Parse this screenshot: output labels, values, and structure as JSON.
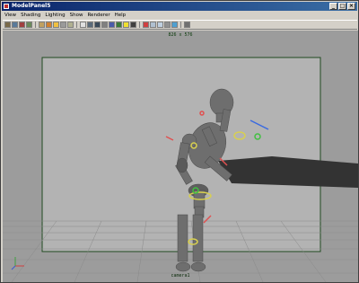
{
  "window": {
    "title": "ModelPanel5",
    "minimize": "_",
    "maximize": "□",
    "close": "×"
  },
  "menu": [
    "View",
    "Shading",
    "Lighting",
    "Show",
    "Renderer",
    "Help"
  ],
  "viewport": {
    "resolution": "826 x 576",
    "camera": "camera1"
  },
  "colors": {
    "title_bg": "#0a246a",
    "viewport_bg": "#9c9c9c",
    "gate": "#b0b0b0",
    "gate_border": "#1f4a1f"
  }
}
